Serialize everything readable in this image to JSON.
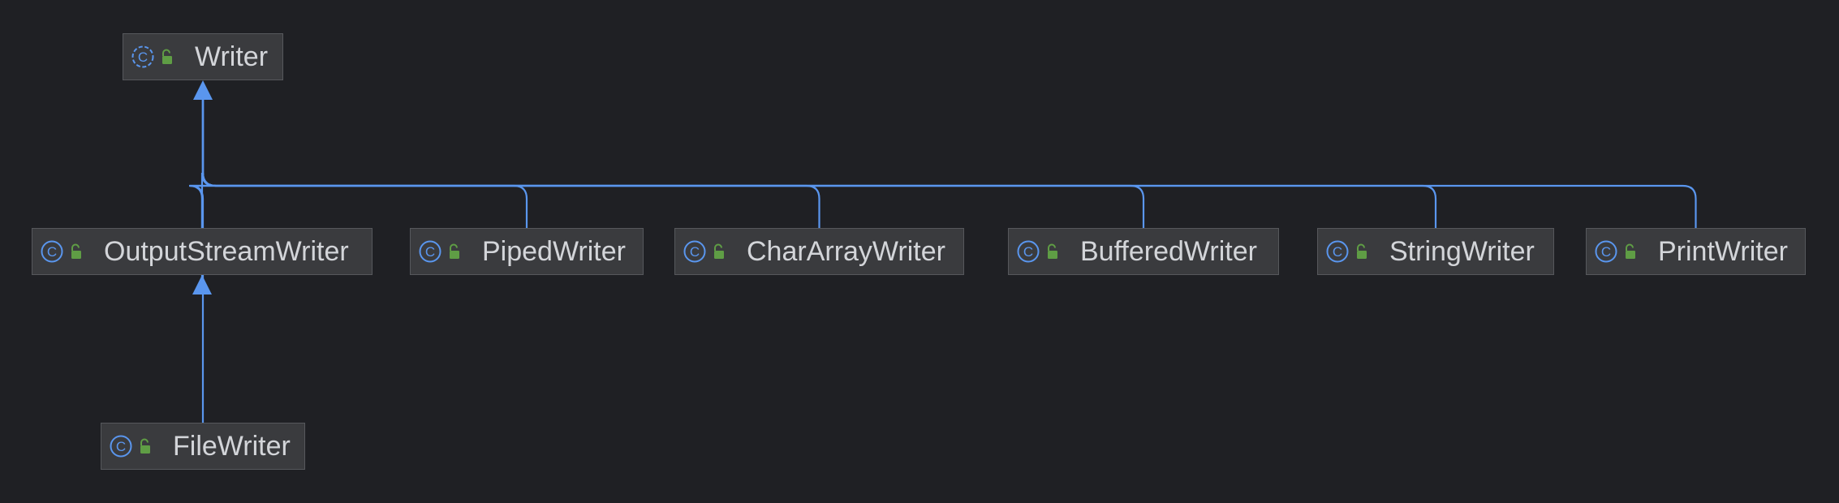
{
  "diagram": {
    "colors": {
      "background": "#1f2024",
      "node_fill": "#3a3b3e",
      "node_border": "#56585c",
      "edge": "#5a96ee",
      "class_icon": "#5a96ee",
      "lock_icon": "#5f9d45",
      "label": "#d3d5d9"
    },
    "nodes": [
      {
        "id": "writer",
        "label": "Writer",
        "icon": "abstract-class-icon",
        "visibility_icon": "public-lock-icon"
      },
      {
        "id": "output-stream-writer",
        "label": "OutputStreamWriter",
        "icon": "class-icon",
        "visibility_icon": "public-lock-icon"
      },
      {
        "id": "piped-writer",
        "label": "PipedWriter",
        "icon": "class-icon",
        "visibility_icon": "public-lock-icon"
      },
      {
        "id": "char-array-writer",
        "label": "CharArrayWriter",
        "icon": "class-icon",
        "visibility_icon": "public-lock-icon"
      },
      {
        "id": "buffered-writer",
        "label": "BufferedWriter",
        "icon": "class-icon",
        "visibility_icon": "public-lock-icon"
      },
      {
        "id": "string-writer",
        "label": "StringWriter",
        "icon": "class-icon",
        "visibility_icon": "public-lock-icon"
      },
      {
        "id": "print-writer",
        "label": "PrintWriter",
        "icon": "class-icon",
        "visibility_icon": "public-lock-icon"
      },
      {
        "id": "file-writer",
        "label": "FileWriter",
        "icon": "class-icon",
        "visibility_icon": "public-lock-icon"
      }
    ],
    "edges": [
      {
        "from": "output-stream-writer",
        "to": "writer",
        "type": "extends"
      },
      {
        "from": "piped-writer",
        "to": "writer",
        "type": "extends"
      },
      {
        "from": "char-array-writer",
        "to": "writer",
        "type": "extends"
      },
      {
        "from": "buffered-writer",
        "to": "writer",
        "type": "extends"
      },
      {
        "from": "string-writer",
        "to": "writer",
        "type": "extends"
      },
      {
        "from": "print-writer",
        "to": "writer",
        "type": "extends"
      },
      {
        "from": "file-writer",
        "to": "output-stream-writer",
        "type": "extends"
      }
    ]
  }
}
